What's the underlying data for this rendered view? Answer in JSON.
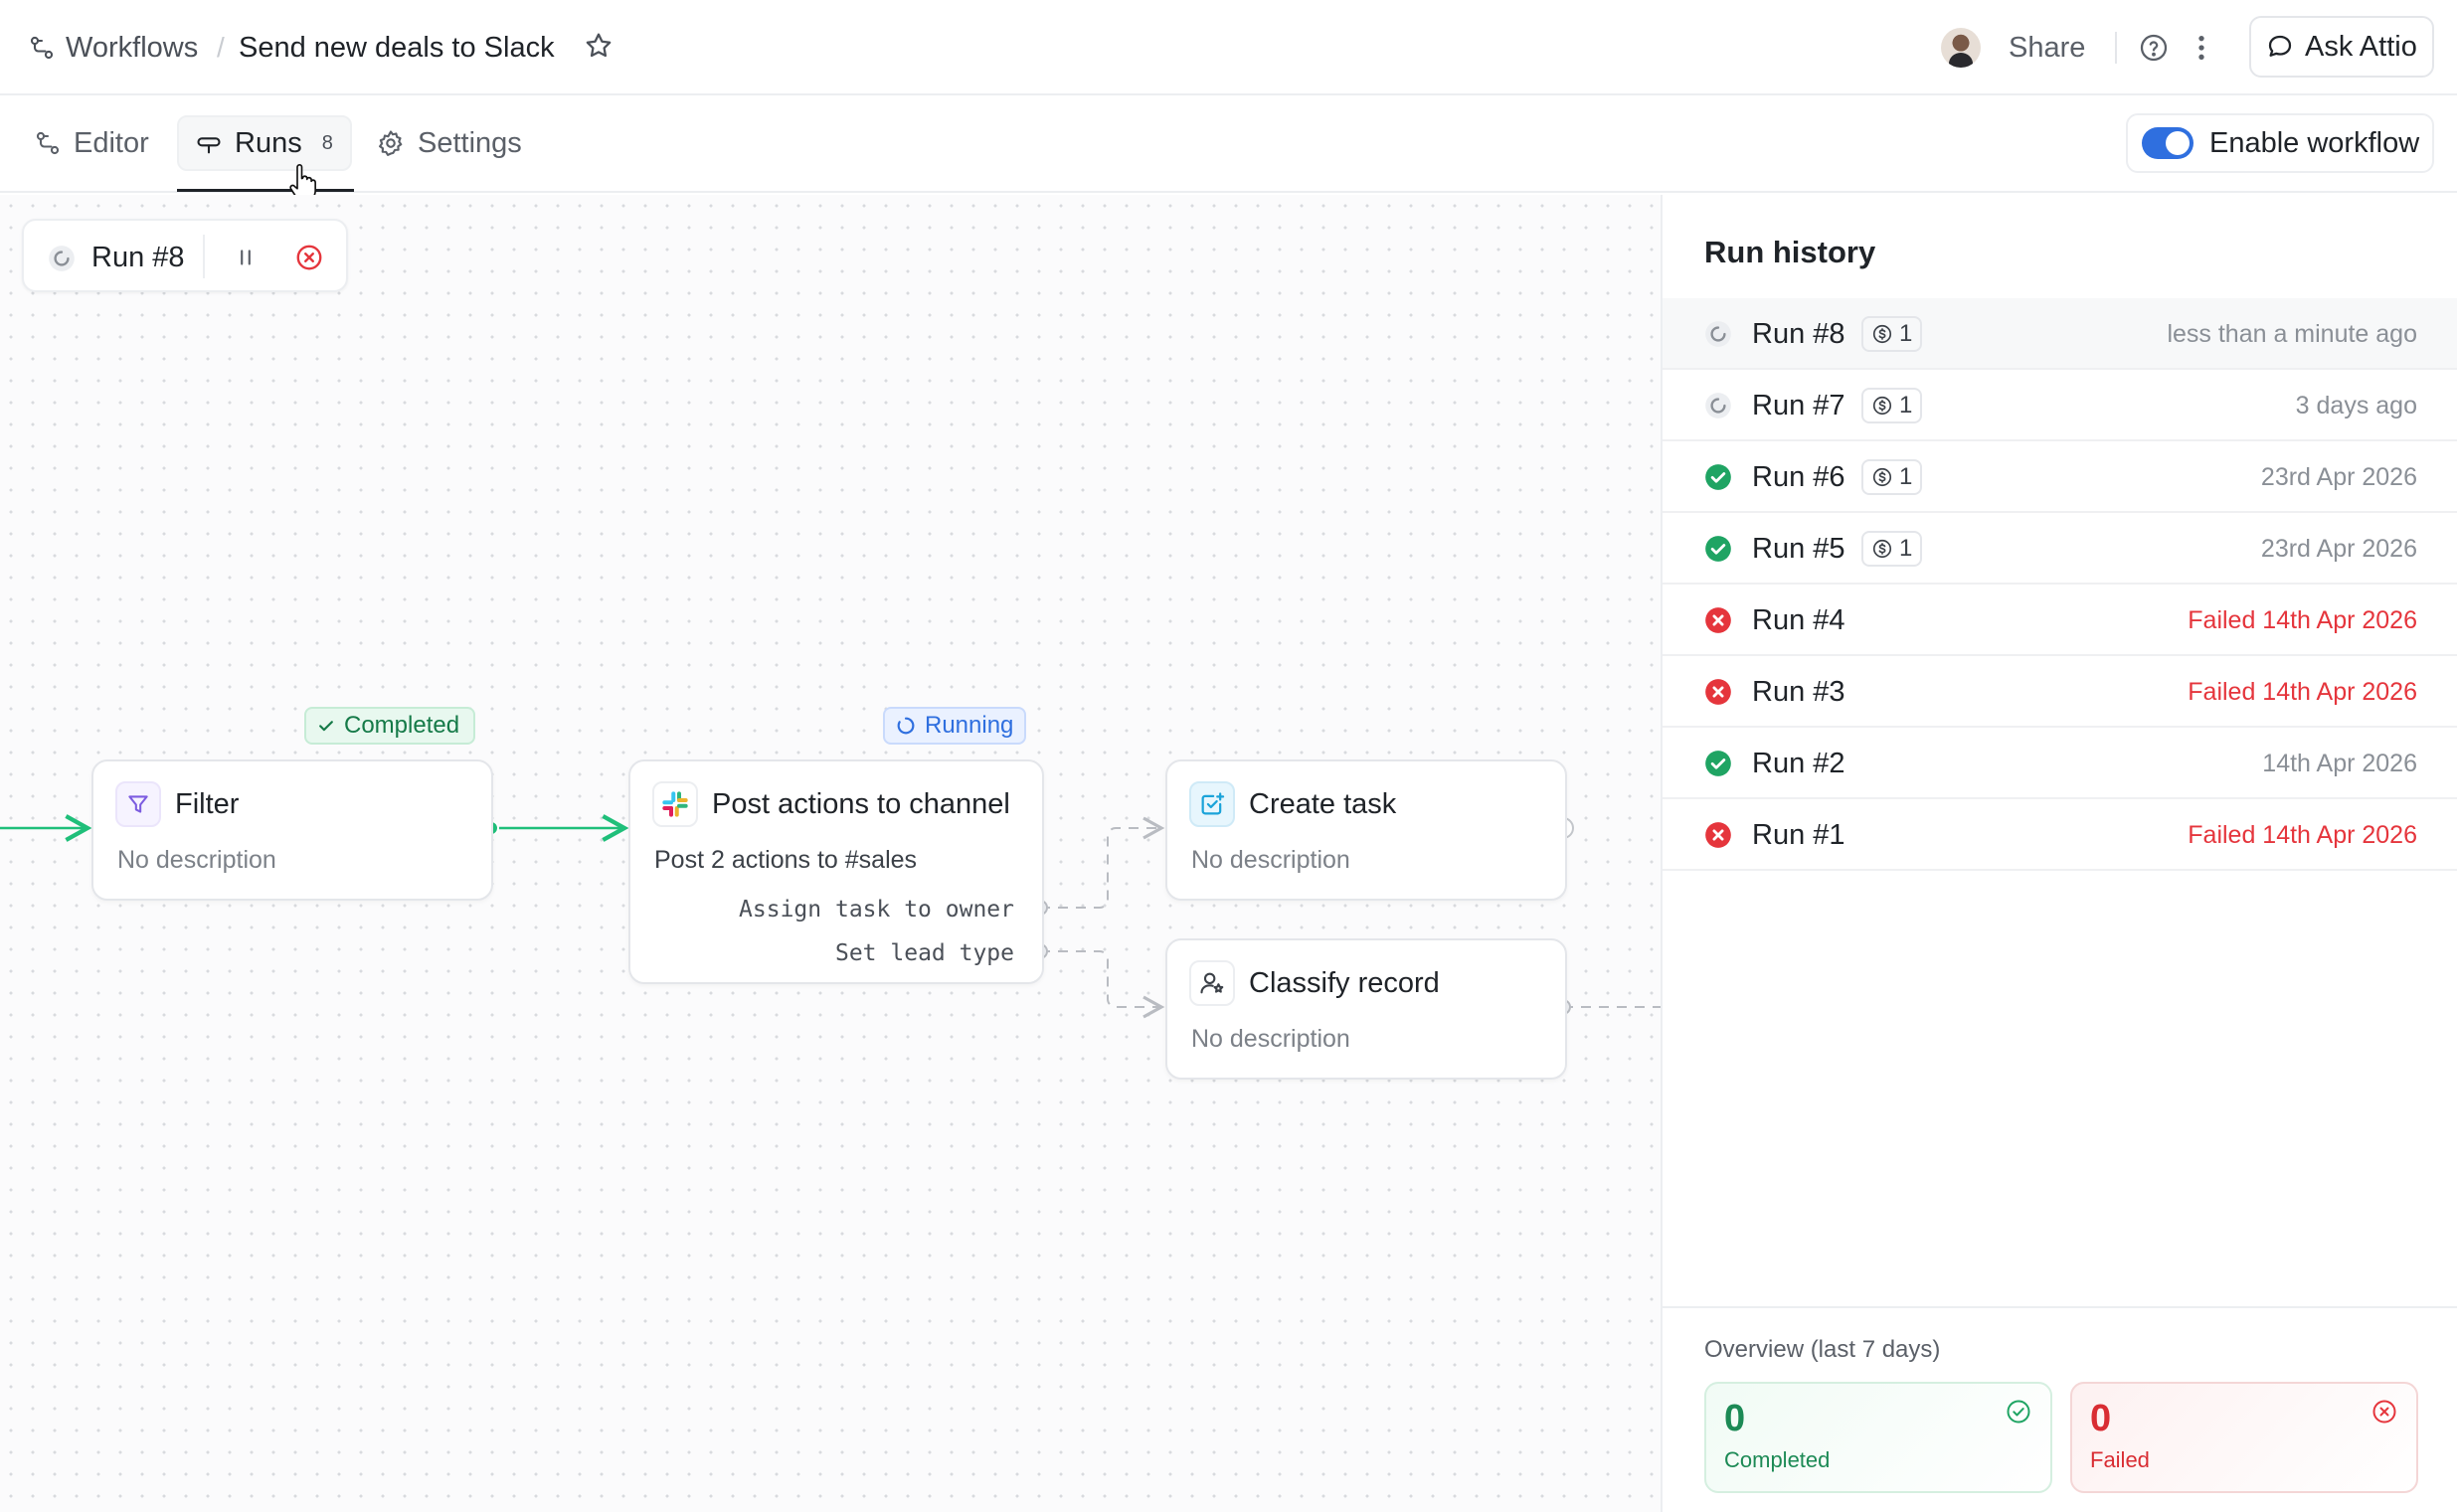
{
  "breadcrumb": {
    "root": "Workflows",
    "title": "Send new deals to Slack"
  },
  "header": {
    "share_label": "Share",
    "ask_label": "Ask Attio"
  },
  "tabs": [
    {
      "label": "Editor"
    },
    {
      "label": "Runs",
      "count": "8"
    },
    {
      "label": "Settings"
    }
  ],
  "enable_workflow": {
    "label": "Enable workflow",
    "enabled": true
  },
  "run_control": {
    "label": "Run #8"
  },
  "canvas": {
    "nodes": {
      "filter": {
        "title": "Filter",
        "description": "No description",
        "status": "Completed"
      },
      "post": {
        "title": "Post actions to channel",
        "subtitle": "Post 2 actions to #sales",
        "status": "Running",
        "branches": [
          "Assign task to owner",
          "Set lead type"
        ]
      },
      "create_task": {
        "title": "Create task",
        "description": "No description"
      },
      "classify": {
        "title": "Classify record",
        "description": "No description"
      }
    }
  },
  "run_history": {
    "title": "Run history",
    "runs": [
      {
        "label": "Run #8",
        "status": "running",
        "credits": "1",
        "time": "less than a minute ago"
      },
      {
        "label": "Run #7",
        "status": "running",
        "credits": "1",
        "time": "3 days ago"
      },
      {
        "label": "Run #6",
        "status": "completed",
        "credits": "1",
        "time": "23rd Apr 2026"
      },
      {
        "label": "Run #5",
        "status": "completed",
        "credits": "1",
        "time": "23rd Apr 2026"
      },
      {
        "label": "Run #4",
        "status": "failed",
        "time": "Failed 14th Apr 2026"
      },
      {
        "label": "Run #3",
        "status": "failed",
        "time": "Failed 14th Apr 2026"
      },
      {
        "label": "Run #2",
        "status": "completed",
        "time": "14th Apr 2026"
      },
      {
        "label": "Run #1",
        "status": "failed",
        "time": "Failed 14th Apr 2026"
      }
    ]
  },
  "overview": {
    "label": "Overview (last 7 days)",
    "completed": {
      "count": "0",
      "label": "Completed"
    },
    "failed": {
      "count": "0",
      "label": "Failed"
    }
  },
  "colors": {
    "accent": "#2f6fdf",
    "success": "#1fa463",
    "failure": "#e5353c"
  }
}
